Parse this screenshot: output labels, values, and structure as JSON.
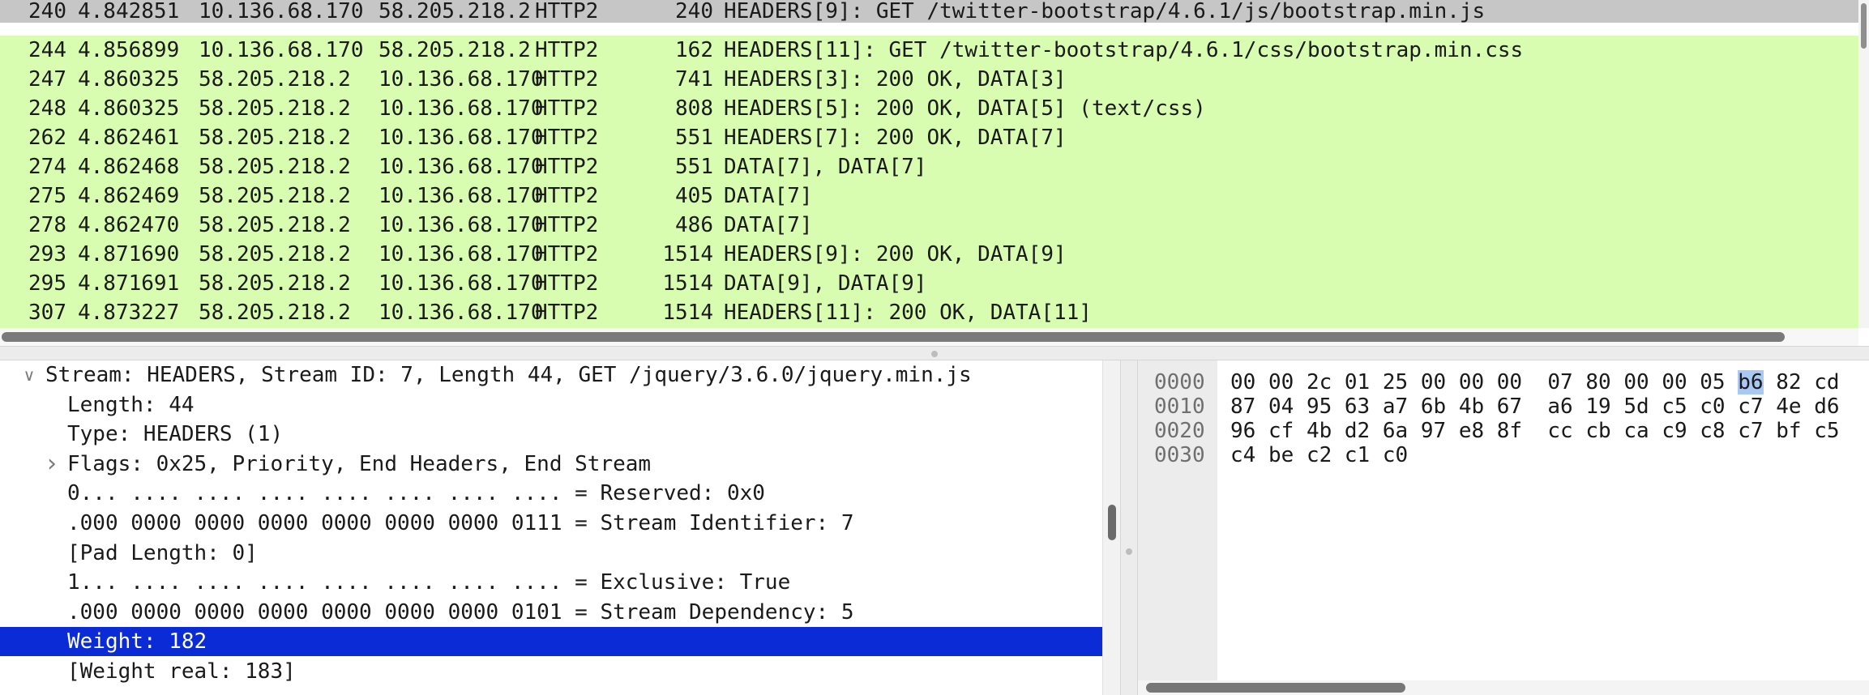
{
  "packets": [
    {
      "no": "240",
      "time": "4.842851",
      "src": "10.136.68.170",
      "dst": "58.205.218.2",
      "proto": "HTTP2",
      "len": "240",
      "info": "HEADERS[9]: GET /twitter-bootstrap/4.6.1/js/bootstrap.min.js",
      "state": "selected"
    },
    {
      "no": "244",
      "time": "4.856899",
      "src": "10.136.68.170",
      "dst": "58.205.218.2",
      "proto": "HTTP2",
      "len": "162",
      "info": "HEADERS[11]: GET /twitter-bootstrap/4.6.1/css/bootstrap.min.css",
      "state": "http2"
    },
    {
      "no": "247",
      "time": "4.860325",
      "src": "58.205.218.2",
      "dst": "10.136.68.170",
      "proto": "HTTP2",
      "len": "741",
      "info": "HEADERS[3]: 200 OK, DATA[3]",
      "state": "http2"
    },
    {
      "no": "248",
      "time": "4.860325",
      "src": "58.205.218.2",
      "dst": "10.136.68.170",
      "proto": "HTTP2",
      "len": "808",
      "info": "HEADERS[5]: 200 OK, DATA[5] (text/css)",
      "state": "http2"
    },
    {
      "no": "262",
      "time": "4.862461",
      "src": "58.205.218.2",
      "dst": "10.136.68.170",
      "proto": "HTTP2",
      "len": "551",
      "info": "HEADERS[7]: 200 OK, DATA[7]",
      "state": "http2"
    },
    {
      "no": "274",
      "time": "4.862468",
      "src": "58.205.218.2",
      "dst": "10.136.68.170",
      "proto": "HTTP2",
      "len": "551",
      "info": "DATA[7], DATA[7]",
      "state": "http2"
    },
    {
      "no": "275",
      "time": "4.862469",
      "src": "58.205.218.2",
      "dst": "10.136.68.170",
      "proto": "HTTP2",
      "len": "405",
      "info": "DATA[7]",
      "state": "http2"
    },
    {
      "no": "278",
      "time": "4.862470",
      "src": "58.205.218.2",
      "dst": "10.136.68.170",
      "proto": "HTTP2",
      "len": "486",
      "info": "DATA[7]",
      "state": "http2"
    },
    {
      "no": "293",
      "time": "4.871690",
      "src": "58.205.218.2",
      "dst": "10.136.68.170",
      "proto": "HTTP2",
      "len": "1514",
      "info": "HEADERS[9]: 200 OK, DATA[9]",
      "state": "http2"
    },
    {
      "no": "295",
      "time": "4.871691",
      "src": "58.205.218.2",
      "dst": "10.136.68.170",
      "proto": "HTTP2",
      "len": "1514",
      "info": "DATA[9], DATA[9]",
      "state": "http2"
    },
    {
      "no": "307",
      "time": "4.873227",
      "src": "58.205.218.2",
      "dst": "10.136.68.170",
      "proto": "HTTP2",
      "len": "1514",
      "info": "HEADERS[11]: 200 OK, DATA[11]",
      "state": "http2"
    }
  ],
  "details": [
    {
      "text": "Stream: HEADERS, Stream ID: 7, Length 44, GET /jquery/3.6.0/jquery.min.js",
      "twisty": "expanded",
      "level": 0
    },
    {
      "text": "Length: 44",
      "twisty": "none",
      "level": 1
    },
    {
      "text": "Type: HEADERS (1)",
      "twisty": "none",
      "level": 1
    },
    {
      "text": "Flags: 0x25, Priority, End Headers, End Stream",
      "twisty": "collapsed",
      "level": 1
    },
    {
      "text": "0... .... .... .... .... .... .... .... = Reserved: 0x0",
      "twisty": "none",
      "level": 1
    },
    {
      "text": ".000 0000 0000 0000 0000 0000 0000 0111 = Stream Identifier: 7",
      "twisty": "none",
      "level": 1
    },
    {
      "text": "[Pad Length: 0]",
      "twisty": "none",
      "level": 1
    },
    {
      "text": "1... .... .... .... .... .... .... .... = Exclusive: True",
      "twisty": "none",
      "level": 1
    },
    {
      "text": ".000 0000 0000 0000 0000 0000 0000 0101 = Stream Dependency: 5",
      "twisty": "none",
      "level": 1
    },
    {
      "text": "Weight: 182",
      "twisty": "none",
      "level": 1,
      "selected": true
    },
    {
      "text": "[Weight real: 183]",
      "twisty": "none",
      "level": 1
    }
  ],
  "bytes": {
    "offsets": [
      "0000",
      "0010",
      "0020",
      "0030"
    ],
    "rows": [
      [
        "00",
        "00",
        "2c",
        "01",
        "25",
        "00",
        "00",
        "00",
        "07",
        "80",
        "00",
        "00",
        "05",
        "b6",
        "82",
        "cd"
      ],
      [
        "87",
        "04",
        "95",
        "63",
        "a7",
        "6b",
        "4b",
        "67",
        "a6",
        "19",
        "5d",
        "c5",
        "c0",
        "c7",
        "4e",
        "d6"
      ],
      [
        "96",
        "cf",
        "4b",
        "d2",
        "6a",
        "97",
        "e8",
        "8f",
        "cc",
        "cb",
        "ca",
        "c9",
        "c8",
        "c7",
        "bf",
        "c5"
      ],
      [
        "c4",
        "be",
        "c2",
        "c1",
        "c0"
      ]
    ],
    "highlight": {
      "row": 0,
      "col": 13
    }
  },
  "colors": {
    "http2_row": "#d8fcb0",
    "selected_row": "#c6c6c6",
    "detail_selected": "#0a2bd6",
    "byte_highlight": "#a9c8f3"
  },
  "icons": {
    "expanded": "chevron-down-icon",
    "collapsed": "chevron-right-icon"
  }
}
